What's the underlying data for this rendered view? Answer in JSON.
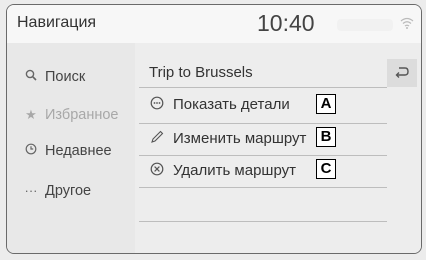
{
  "header": {
    "title": "Навигация",
    "clock": "10:40"
  },
  "sidebar": {
    "items": [
      {
        "label": "Поиск",
        "icon": "search-icon"
      },
      {
        "label": "Избранное",
        "icon": "star-icon",
        "disabled": true
      },
      {
        "label": "Недавнее",
        "icon": "clock-icon"
      },
      {
        "label": "Другое",
        "icon": "more-icon"
      }
    ]
  },
  "main": {
    "title": "Trip to Brussels",
    "back_icon": "back-arrow-icon",
    "rows": [
      {
        "label": "Показать детали",
        "icon": "details-icon",
        "callout": "A"
      },
      {
        "label": "Изменить маршрут",
        "icon": "pencil-icon",
        "callout": "B"
      },
      {
        "label": "Удалить маршрут",
        "icon": "delete-icon",
        "callout": "C"
      }
    ]
  }
}
